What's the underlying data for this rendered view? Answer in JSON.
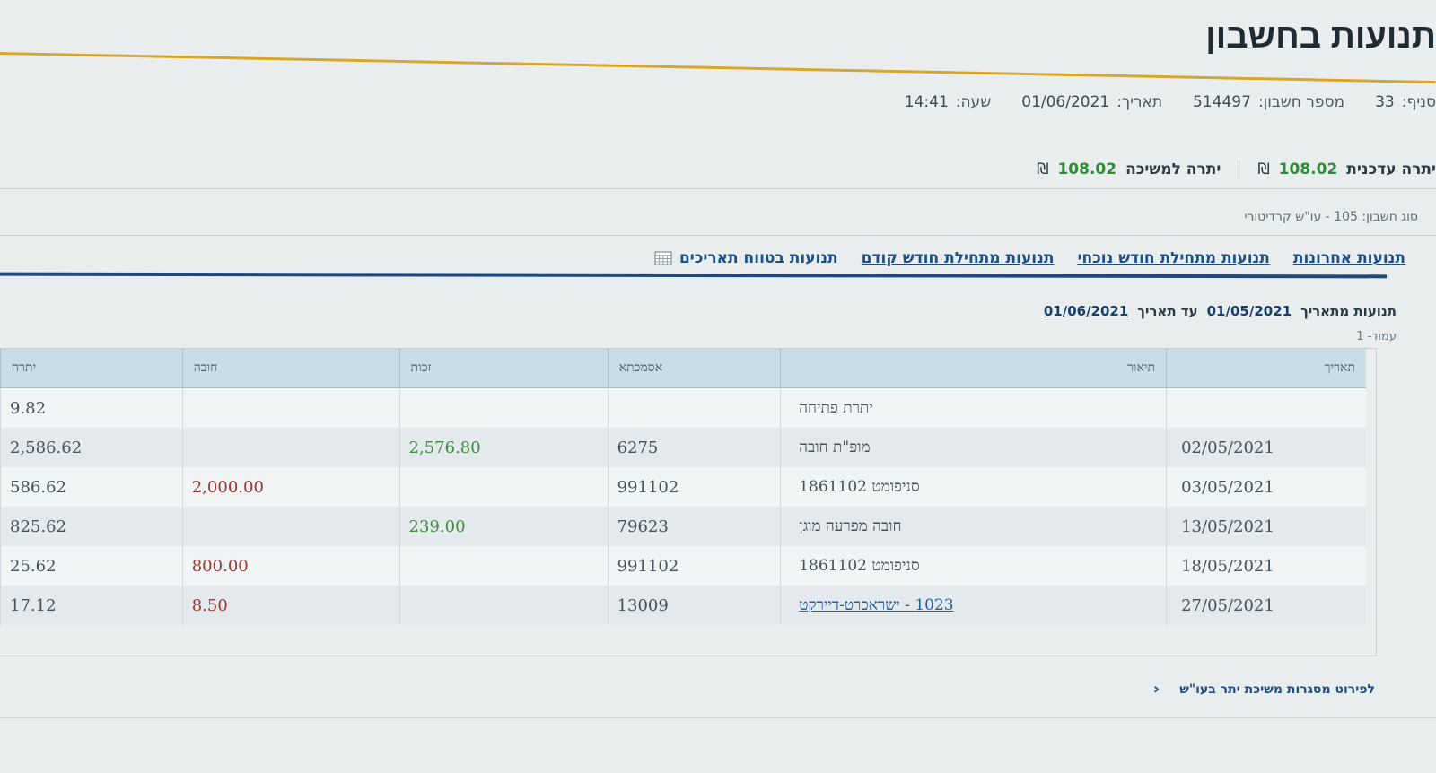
{
  "header": {
    "title": "תנועות בחשבון"
  },
  "info": {
    "branch_label": "סניף:",
    "branch_value": "33",
    "account_label": "מספר חשבון:",
    "account_value": "514497",
    "date_label": "תאריך:",
    "date_value": "01/06/2021",
    "time_label": "שעה:",
    "time_value": "14:41"
  },
  "balances": {
    "current_label": "יתרה עדכנית",
    "current_value": "108.02",
    "withdraw_label": "יתרה למשיכה",
    "withdraw_value": "108.02",
    "currency": "₪"
  },
  "account_type": "סוג חשבון: 105 - עו\"ש קרדיטורי",
  "tabs": [
    {
      "label": "תנועות אחרונות"
    },
    {
      "label": "תנועות מתחילת חודש נוכחי"
    },
    {
      "label": "תנועות מתחילת חודש קודם"
    },
    {
      "label": "תנועות בטווח תאריכים"
    }
  ],
  "range": {
    "from_label": "תנועות מתאריך",
    "from_value": "01/05/2021",
    "to_label": "עד תאריך",
    "to_value": "01/06/2021"
  },
  "page_label": "עמוד- 1",
  "table": {
    "headers": {
      "date": "תאריך",
      "description": "תיאור",
      "reference": "אסמכתא",
      "credit": "זכות",
      "debit": "חובה",
      "balance": "יתרה"
    },
    "rows": [
      {
        "date": "",
        "description": "יתרת פתיחה",
        "reference": "",
        "credit": "",
        "debit": "",
        "balance": "9.82"
      },
      {
        "date": "02/05/2021",
        "description": "מופ\"ת חובה",
        "reference": "6275",
        "credit": "2,576.80",
        "debit": "",
        "balance": "2,586.62"
      },
      {
        "date": "03/05/2021",
        "description": "סניפומט 1861102",
        "reference": "991102",
        "credit": "",
        "debit": "2,000.00",
        "balance": "586.62"
      },
      {
        "date": "13/05/2021",
        "description": "חובה מפרעה מוגן",
        "reference": "79623",
        "credit": "239.00",
        "debit": "",
        "balance": "825.62"
      },
      {
        "date": "18/05/2021",
        "description": "סניפומט 1861102",
        "reference": "991102",
        "credit": "",
        "debit": "800.00",
        "balance": "25.62"
      },
      {
        "date": "27/05/2021",
        "description": "1023 - ישראכרט-דיירקט",
        "reference": "13009",
        "credit": "",
        "debit": "8.50",
        "balance": "17.12"
      }
    ]
  },
  "footer": {
    "link_label": "לפירוט מסגרות משיכת יתר בעו\"ש"
  },
  "colors": {
    "accent_rule": "#d7a62a",
    "tabs_rule": "#1d4a7a",
    "credit": "#3d8f3a",
    "debit": "#9b3a36",
    "balance_green": "#2e8b36"
  }
}
